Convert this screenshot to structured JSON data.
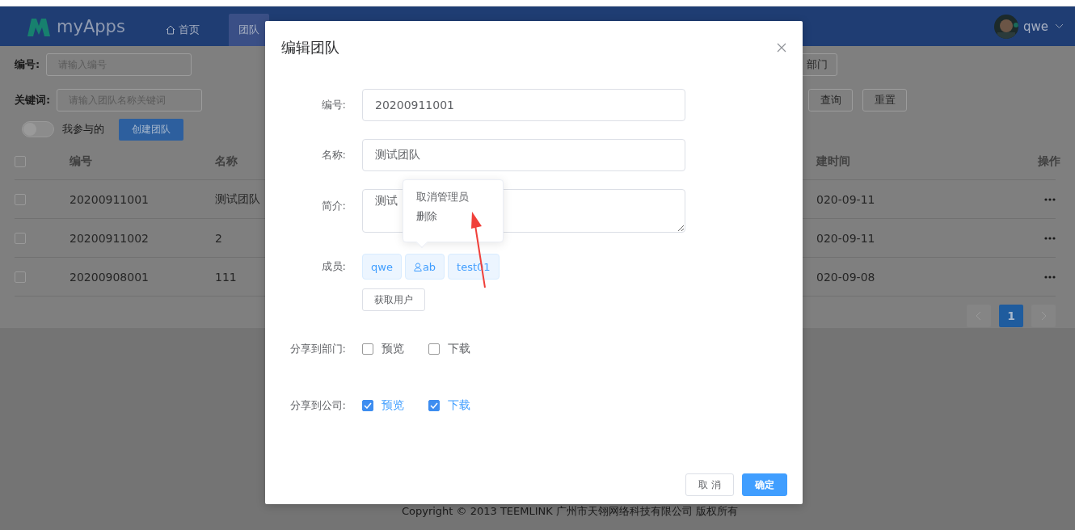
{
  "header": {
    "logo": "myApps",
    "nav": [
      {
        "label": "首页",
        "kind": "home",
        "selected": false
      },
      {
        "label": "团队",
        "kind": "plain",
        "selected": true
      }
    ],
    "user": {
      "name": "qwe"
    }
  },
  "filters": {
    "number_label": "编号:",
    "number_placeholder": "请输入编号",
    "keyword_label": "关键词:",
    "keyword_placeholder": "请输入团队名称关键词",
    "dept_button": "部门",
    "query_button": "查询",
    "reset_button": "重置",
    "toggle": {
      "label": "我参与的",
      "on": false
    },
    "create_button": "创建团队"
  },
  "table": {
    "header_checked": false,
    "columns": [
      "编号",
      "名称",
      "建时间",
      "操作"
    ],
    "rows": [
      {
        "checked": false,
        "number": "20200911001",
        "name": "测试团队",
        "created": "020-09-11"
      },
      {
        "checked": false,
        "number": "20200911002",
        "name": "2",
        "created": "020-09-11"
      },
      {
        "checked": false,
        "number": "20200908001",
        "name": "111",
        "created": "020-09-08"
      }
    ]
  },
  "pagination": {
    "pages": [
      {
        "label": "1",
        "selected": true
      }
    ]
  },
  "footer": "Copyright © 2013 TEEMLINK 广州市天翎网络科技有限公司 版权所有",
  "dialog": {
    "title": "编辑团队",
    "number": {
      "label": "编号:",
      "value": "20200911001"
    },
    "name": {
      "label": "名称:",
      "value": "测试团队"
    },
    "intro": {
      "label": "简介:",
      "value": "测试"
    },
    "members": {
      "label": "成员:",
      "tags": [
        {
          "name": "qwe",
          "admin": false
        },
        {
          "name": "ab",
          "admin": true
        },
        {
          "name": "test01",
          "admin": false
        }
      ],
      "fetch_button": "获取用户"
    },
    "popover": {
      "items": [
        "取消管理员",
        "删除"
      ]
    },
    "share_department": {
      "label": "分享到部门:",
      "options": [
        {
          "label": "预览",
          "checked": false
        },
        {
          "label": "下载",
          "checked": false
        }
      ]
    },
    "share_company": {
      "label": "分享到公司:",
      "options": [
        {
          "label": "预览",
          "checked": true
        },
        {
          "label": "下载",
          "checked": true
        }
      ]
    },
    "cancel_button": "取 消",
    "ok_button": "确定"
  }
}
